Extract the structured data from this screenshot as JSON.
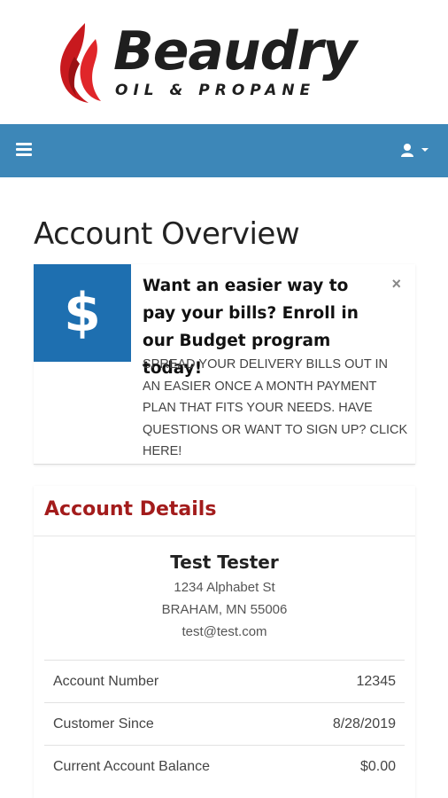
{
  "header": {
    "logo_name": "Beaudry",
    "logo_subtitle": "OIL & PROPANE",
    "logo_flame_color": "#c8191e"
  },
  "navbar": {
    "background": "#3d87b8",
    "menu_icon": "hamburger-icon",
    "user_icon": "user-icon"
  },
  "page": {
    "title": "Account Overview"
  },
  "promo": {
    "icon": "dollar-icon",
    "icon_glyph": "$",
    "title": "Want an easier way to pay your bills? Enroll in our Budget program today!",
    "body": "SPREAD YOUR DELIVERY BILLS OUT IN AN EASIER ONCE A MONTH PAYMENT PLAN THAT FITS YOUR NEEDS. HAVE QUESTIONS OR WANT TO SIGN UP? CLICK HERE!",
    "close_glyph": "×"
  },
  "account": {
    "heading": "Account Details",
    "name": "Test Tester",
    "address_line1": "1234 Alphabet St",
    "address_line2": "BRAHAM, MN 55006",
    "email": "test@test.com",
    "rows": [
      {
        "label": "Account Number",
        "value": "12345"
      },
      {
        "label": "Customer Since",
        "value": "8/28/2019"
      },
      {
        "label": "Current Account Balance",
        "value": "$0.00"
      }
    ]
  }
}
